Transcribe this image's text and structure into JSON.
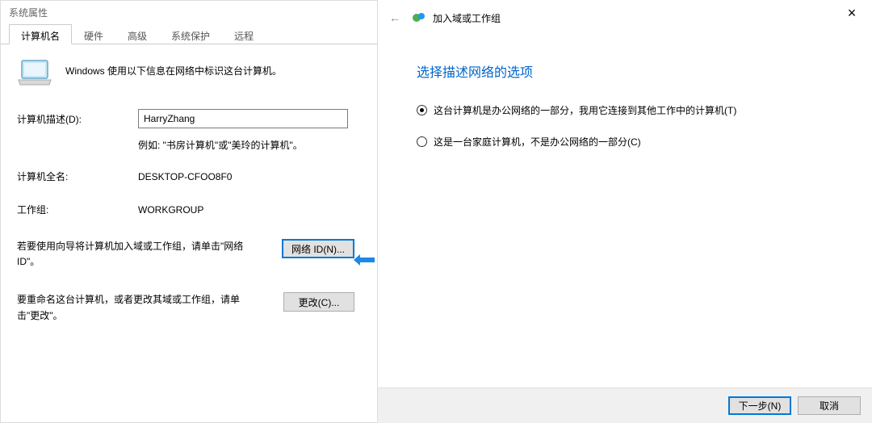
{
  "leftDialog": {
    "title": "系统属性",
    "tabs": [
      "计算机名",
      "硬件",
      "高级",
      "系统保护",
      "远程"
    ],
    "activeTab": 0,
    "intro": "Windows 使用以下信息在网络中标识这台计算机。",
    "fields": {
      "descLabel": "计算机描述(D):",
      "descValue": "HarryZhang",
      "descHint": "例如: \"书房计算机\"或\"美玲的计算机\"。",
      "fullNameLabel": "计算机全名:",
      "fullNameValue": "DESKTOP-CFOO8F0",
      "workgroupLabel": "工作组:",
      "workgroupValue": "WORKGROUP"
    },
    "networkIdText": "若要使用向导将计算机加入域或工作组，请单击\"网络ID\"。",
    "networkIdButton": "网络 ID(N)...",
    "changeText": "要重命名这台计算机，或者更改其域或工作组，请单击\"更改\"。",
    "changeButton": "更改(C)..."
  },
  "rightDialog": {
    "title": "加入域或工作组",
    "heading": "选择描述网络的选项",
    "option1": "这台计算机是办公网络的一部分，我用它连接到其他工作中的计算机(T)",
    "option2": "这是一台家庭计算机，不是办公网络的一部分(C)",
    "selectedOption": 0,
    "nextButton": "下一步(N)",
    "cancelButton": "取消"
  }
}
